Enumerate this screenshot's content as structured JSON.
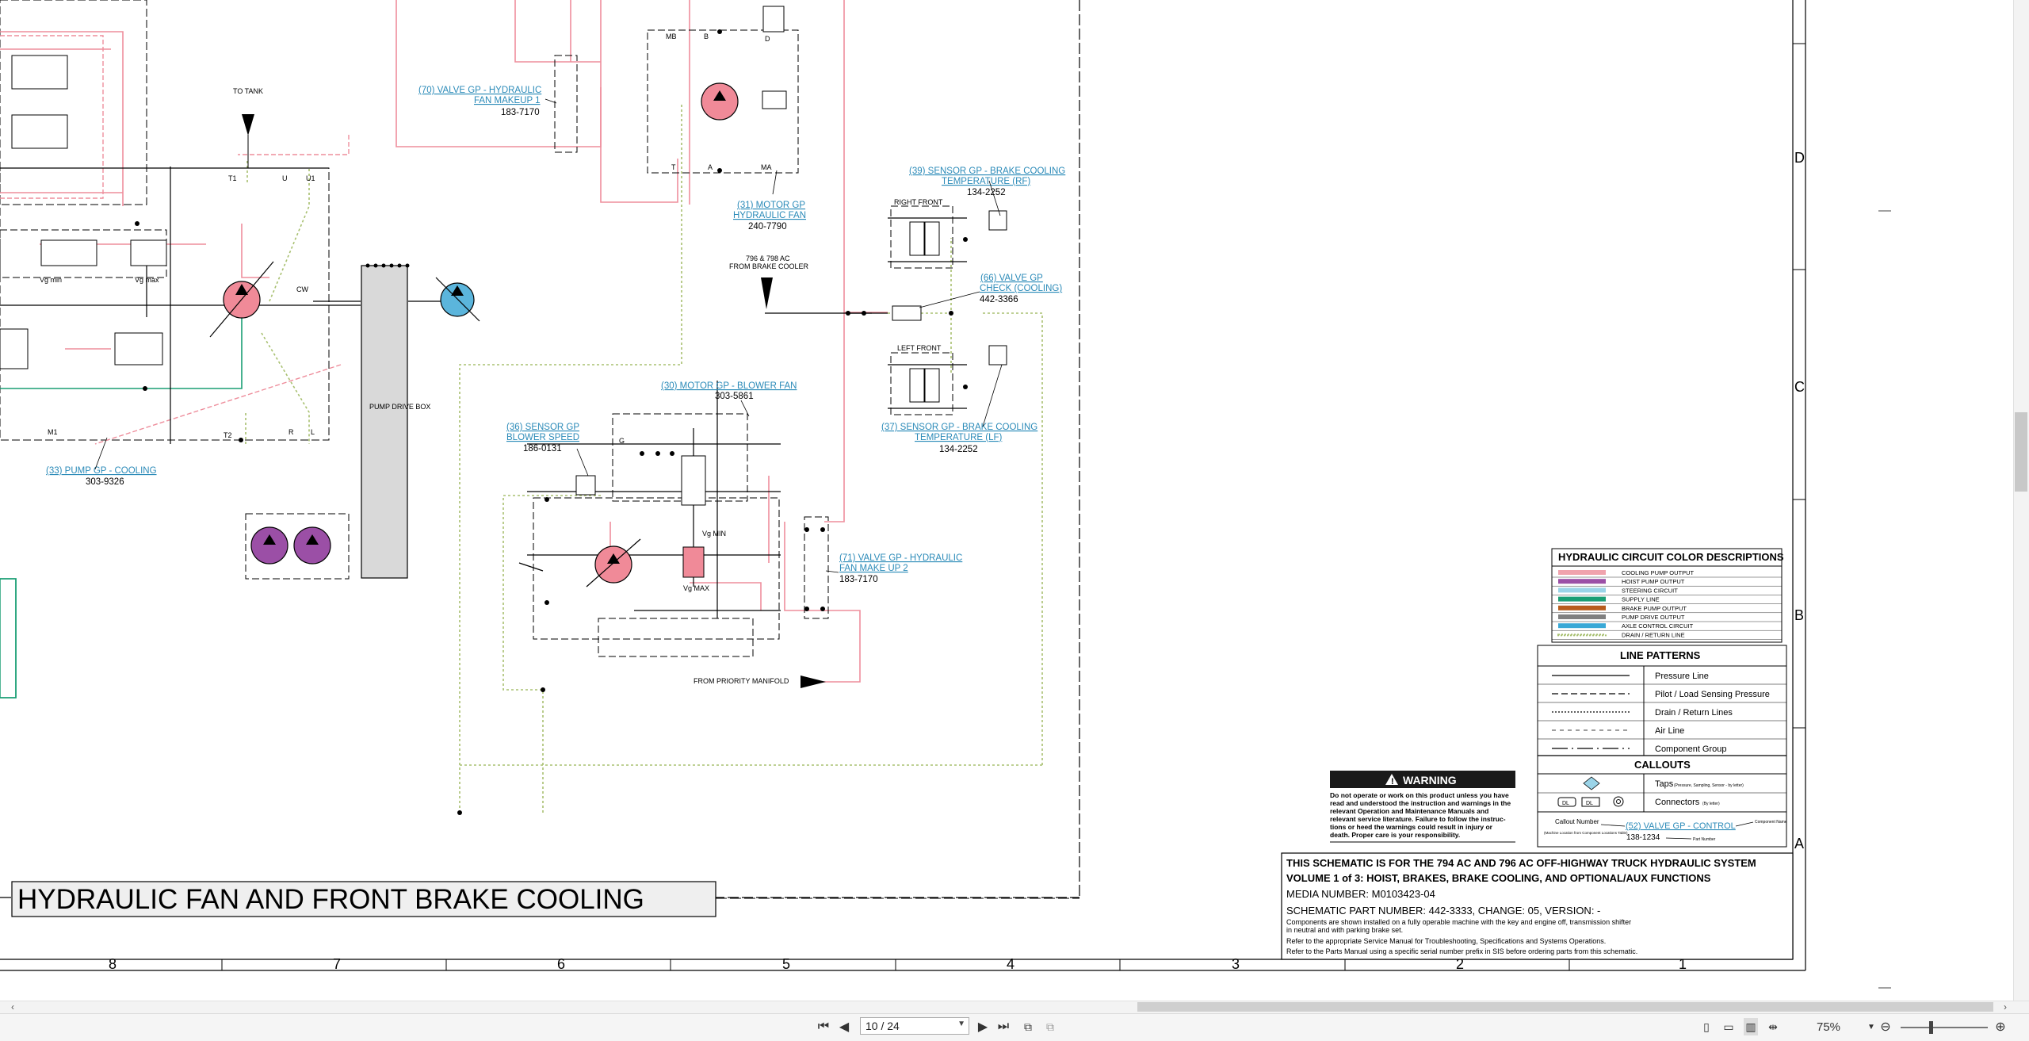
{
  "schematic": {
    "title": "HYDRAULIC FAN AND FRONT BRAKE COOLING",
    "labels": {
      "to_tank": "TO TANK",
      "vg_min": "Vg min",
      "vg_max": "Vg max",
      "t1": "T1",
      "u": "U",
      "u1": "U1",
      "cw": "CW",
      "m1": "M1",
      "t2": "T2",
      "r": "R",
      "l": "L",
      "pump_drive_box": "PUMP DRIVE BOX",
      "mb": "MB",
      "b": "B",
      "d": "D",
      "t": "T",
      "a": "A",
      "ma": "MA",
      "right_front": "RIGHT FRONT",
      "left_front": "LEFT FRONT",
      "from_brake_cooler_1": "796 & 798 AC",
      "from_brake_cooler_2": "FROM BRAKE COOLER",
      "g": "G",
      "vg_min_upper": "Vg MIN",
      "vg_max_upper": "Vg MAX",
      "from_priority_manifold": "FROM PRIORITY MANIFOLD"
    },
    "callouts": [
      {
        "link1": "(70) VALVE GP - HYDRAULIC",
        "link2": "FAN MAKEUP 1",
        "part": "183-7170"
      },
      {
        "link1": "(31) MOTOR GP",
        "link2": "HYDRAULIC FAN",
        "part": "240-7790"
      },
      {
        "link1": "(39) SENSOR GP - BRAKE COOLING",
        "link2": "TEMPERATURE (RF)",
        "part": "134-2252"
      },
      {
        "link1": "(66) VALVE GP",
        "link2": "CHECK (COOLING)",
        "part": "442-3366"
      },
      {
        "link1": "(30) MOTOR GP - BLOWER FAN",
        "link2": "",
        "part": "303-5861"
      },
      {
        "link1": "(36) SENSOR GP",
        "link2": "BLOWER SPEED",
        "part": "186-0131"
      },
      {
        "link1": "(37) SENSOR GP - BRAKE COOLING",
        "link2": "TEMPERATURE (LF)",
        "part": "134-2252"
      },
      {
        "link1": "(71) VALVE GP - HYDRAULIC",
        "link2": "FAN MAKE UP 2",
        "part": "183-7170"
      },
      {
        "link1": "(33) PUMP GP - COOLING",
        "link2": "",
        "part": "303-9326"
      }
    ],
    "legend": {
      "color_title": "HYDRAULIC CIRCUIT COLOR DESCRIPTIONS",
      "colors": [
        {
          "label": "COOLING PUMP OUTPUT",
          "color": "#f0a3ad"
        },
        {
          "label": "HOIST PUMP OUTPUT",
          "color": "#9b4fa6"
        },
        {
          "label": "STEERING CIRCUIT",
          "color": "#9bd4e8"
        },
        {
          "label": "SUPPLY LINE",
          "color": "#1a9e74"
        },
        {
          "label": "BRAKE PUMP OUTPUT",
          "color": "#b85c1c"
        },
        {
          "label": "PUMP DRIVE OUTPUT",
          "color": "#808080"
        },
        {
          "label": "AXLE CONTROL CIRCUIT",
          "color": "#39a8d6"
        },
        {
          "label": "DRAIN / RETURN LINE",
          "color": "#a8c070"
        }
      ],
      "patterns_title": "LINE PATTERNS",
      "patterns": [
        "Pressure Line",
        "Pilot / Load Sensing Pressure",
        "Drain / Return Lines",
        "Air Line",
        "Component Group"
      ],
      "callouts_title": "CALLOUTS",
      "taps": "Taps",
      "taps_note": "(Pressure, Sampling, Sensor - by letter)",
      "connectors": "Connectors",
      "connectors_note": "(By letter)",
      "conn_dl": "DL",
      "callout_number": "Callout Number",
      "callout_note": "(Machine Location from Component Locations Table)",
      "example_link": "(52) VALVE GP - CONTROL",
      "example_part": "138-1234",
      "component_name": "Component Name",
      "part_number": "Part Number"
    },
    "warning": {
      "title": "WARNING",
      "lines": [
        "Do not operate or work on this product unless you have",
        "read and understood the instruction and warnings in the",
        "relevant Operation and Maintenance Manuals and",
        "relevant service literature. Failure to follow the instruc-",
        "tions or heed the warnings could result in injury or",
        "death. Proper care is your responsibility."
      ]
    },
    "title_block": {
      "line1": "THIS SCHEMATIC IS FOR THE 794 AC AND 796 AC OFF-HIGHWAY TRUCK HYDRAULIC SYSTEM",
      "line2": "VOLUME 1 of 3: HOIST, BRAKES, BRAKE COOLING, AND OPTIONAL/AUX FUNCTIONS",
      "line3": "MEDIA NUMBER: M0103423-04",
      "line4": "SCHEMATIC PART NUMBER: 442-3333, CHANGE: 05, VERSION: -",
      "line5": "Components are shown installed on a fully operable machine with the key and engine off, transmission shifter",
      "line6": "in neutral and with parking brake set.",
      "line7": "Refer to the appropriate Service Manual for Troubleshooting, Specifications and Systems Operations.",
      "line8": "Refer to the Parts Manual using a specific serial number prefix in SIS before ordering parts from this schematic."
    },
    "columns": [
      "8",
      "7",
      "6",
      "5",
      "4",
      "3",
      "2",
      "1"
    ],
    "rows": [
      "D",
      "C",
      "B",
      "A"
    ]
  },
  "toolbar": {
    "page_indicator": "10 / 24",
    "zoom": "75%",
    "first_icon": "first-page-icon",
    "prev_icon": "prev-page-icon",
    "next_icon": "next-page-icon",
    "last_icon": "last-page-icon"
  }
}
